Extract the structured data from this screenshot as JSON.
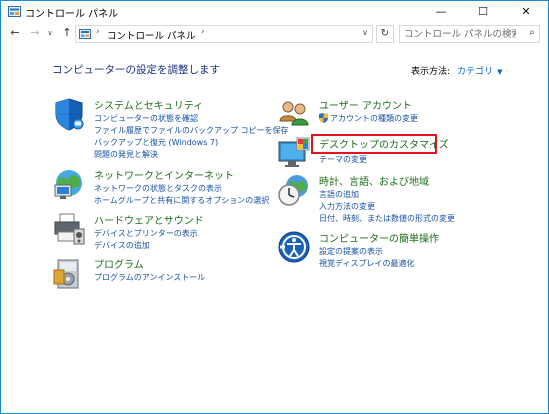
{
  "window": {
    "title": "コントロール パネル",
    "controls": {
      "minimize": "—",
      "maximize": "☐",
      "close": "✕"
    }
  },
  "nav": {
    "back": "←",
    "forward": "→",
    "recent": "∨",
    "up": "↑",
    "breadcrumb_sep": "›",
    "breadcrumb": "コントロール パネル",
    "breadcrumb_end_sep": "›",
    "address_dropdown": "∨",
    "refresh": "↻",
    "search_placeholder": "コントロール パネルの検索",
    "search_icon": "⌕"
  },
  "main": {
    "heading": "コンピューターの設定を調整します",
    "view_by_label": "表示方法:",
    "view_by_value": "カテゴリ",
    "view_by_arrow": "▼"
  },
  "categories_left": [
    {
      "title": "システムとセキュリティ",
      "icon": "shield-icon",
      "links": [
        "コンピューターの状態を確認",
        "ファイル履歴でファイルのバックアップ コピーを保存",
        "バックアップと復元 (Windows 7)",
        "問題の発見と解決"
      ]
    },
    {
      "title": "ネットワークとインターネット",
      "icon": "network-icon",
      "links": [
        "ネットワークの状態とタスクの表示",
        "ホームグループと共有に関するオプションの選択"
      ]
    },
    {
      "title": "ハードウェアとサウンド",
      "icon": "printer-icon",
      "links": [
        "デバイスとプリンターの表示",
        "デバイスの追加"
      ]
    },
    {
      "title": "プログラム",
      "icon": "programs-icon",
      "links": [
        "プログラムのアンインストール"
      ]
    }
  ],
  "categories_right": [
    {
      "title": "ユーザー アカウント",
      "icon": "users-icon",
      "links": [
        "アカウントの種類の変更"
      ]
    },
    {
      "title": "デスクトップのカスタマイズ",
      "icon": "desktop-icon",
      "links": [
        "テーマの変更"
      ]
    },
    {
      "title": "時計、言語、および地域",
      "icon": "clock-globe-icon",
      "links": [
        "言語の追加",
        "入力方法の変更",
        "日付、時刻、または数値の形式の変更"
      ]
    },
    {
      "title": "コンピューターの簡単操作",
      "icon": "ease-of-access-icon",
      "links": [
        "設定の提案の表示",
        "視覚ディスプレイの最適化"
      ]
    }
  ],
  "colors": {
    "category_title": "#1c6d1a",
    "link": "#1650a5",
    "heading": "#1e3287",
    "highlight_border": "#e0141e"
  }
}
